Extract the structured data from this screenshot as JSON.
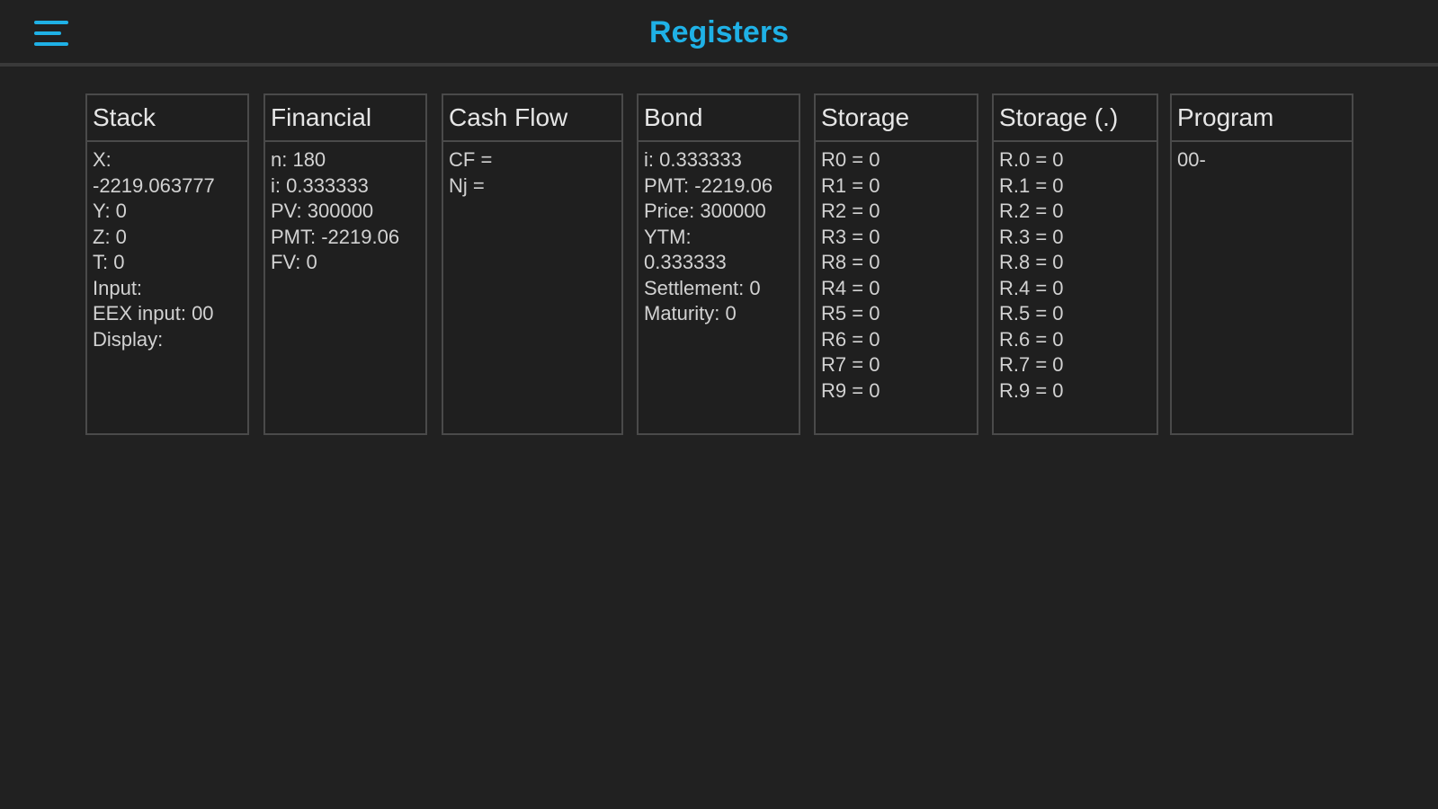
{
  "header": {
    "title": "Registers",
    "menu_icon": "hamburger-menu-icon"
  },
  "colors": {
    "background": "#212121",
    "accent": "#1fb1e6",
    "panel_border": "#4a4a4a",
    "text": "#d2d2d2"
  },
  "panels": [
    {
      "title": "Stack",
      "lines": [
        "X:",
        "-2219.063777",
        "Y: 0",
        "Z: 0",
        "T: 0",
        "Input:",
        "EEX input: 00",
        "Display:"
      ]
    },
    {
      "title": "Financial",
      "lines": [
        "n: 180",
        "i: 0.333333",
        "PV: 300000",
        "PMT: -2219.06",
        "FV: 0"
      ]
    },
    {
      "title": "Cash Flow",
      "lines": [
        "CF =",
        "Nj ="
      ]
    },
    {
      "title": "Bond",
      "lines": [
        "i: 0.333333",
        "PMT: -2219.06",
        "Price: 300000",
        "YTM:",
        "0.333333",
        "Settlement: 0",
        "Maturity: 0"
      ]
    },
    {
      "title": "Storage",
      "lines": [
        "R0 = 0",
        "R1 = 0",
        "R2 = 0",
        "R3 = 0",
        "R8 = 0",
        "R4 = 0",
        "R5 = 0",
        "R6 = 0",
        "R7 = 0",
        "R9 = 0"
      ]
    },
    {
      "title": "Storage (.)",
      "lines": [
        "R.0 = 0",
        "R.1 = 0",
        "R.2 = 0",
        "R.3 = 0",
        "R.8 = 0",
        "R.4 = 0",
        "R.5 = 0",
        "R.6 = 0",
        "R.7 = 0",
        "R.9 = 0"
      ]
    },
    {
      "title": "Program",
      "lines": [
        "00-"
      ]
    }
  ]
}
